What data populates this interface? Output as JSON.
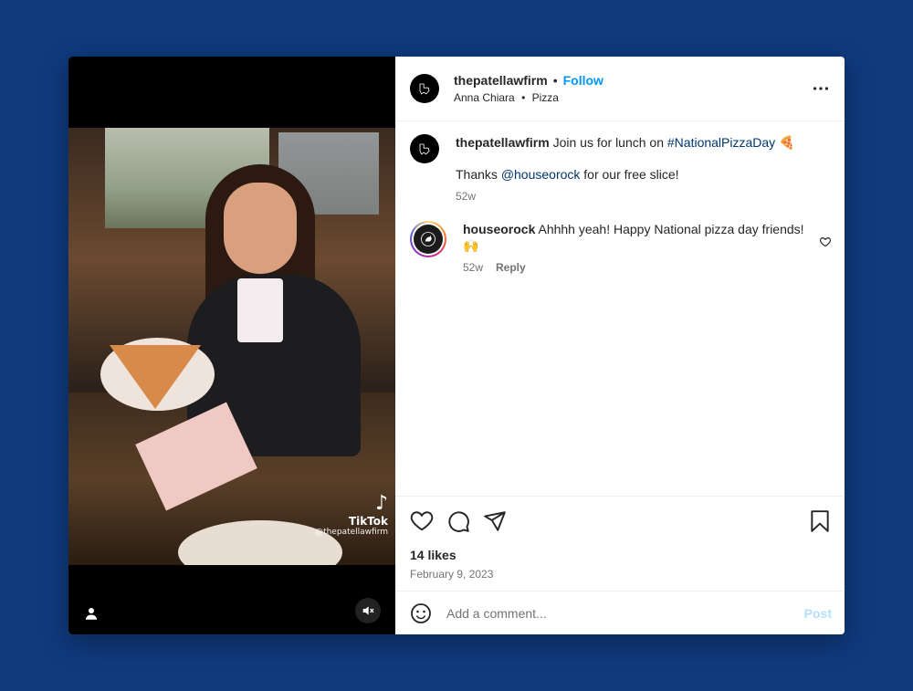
{
  "media": {
    "tiktok_label": "TikTok",
    "tiktok_handle": "@thepatellawfirm"
  },
  "post": {
    "username": "thepatellawfirm",
    "follow_label": "Follow",
    "separator": "•",
    "tagged_user": "Anna Chiara",
    "location": "Pizza"
  },
  "caption": {
    "username": "thepatellawfirm",
    "text_before": "Join us for lunch on ",
    "hashtag": "#NationalPizzaDay",
    "emoji": "🍕",
    "line2_before": "Thanks ",
    "mention": "@houseorock",
    "line2_after": " for our free slice!",
    "time": "52w"
  },
  "comments": [
    {
      "username": "houseorock",
      "text": "Ahhhh yeah! Happy National pizza day friends! 🙌",
      "time": "52w",
      "reply_label": "Reply"
    }
  ],
  "stats": {
    "likes": "14 likes",
    "date": "February 9, 2023"
  },
  "comment_box": {
    "placeholder": "Add a comment...",
    "post_label": "Post"
  },
  "colors": {
    "background": "#0f3a7d",
    "link": "#0095f6",
    "post_disabled": "#b2dffc"
  }
}
